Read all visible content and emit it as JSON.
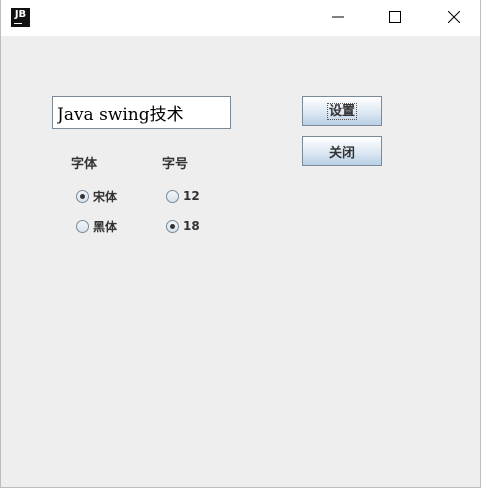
{
  "titlebar": {
    "app_icon_text": "JB"
  },
  "form": {
    "text_field_value": "Java swing技术",
    "set_button_label": "设置",
    "close_button_label": "关闭",
    "font_label": "字体",
    "size_label": "字号",
    "font_options": [
      {
        "label": "宋体",
        "selected": true
      },
      {
        "label": "黑体",
        "selected": false
      }
    ],
    "size_options": [
      {
        "label": "12",
        "selected": false
      },
      {
        "label": "18",
        "selected": true
      }
    ]
  }
}
